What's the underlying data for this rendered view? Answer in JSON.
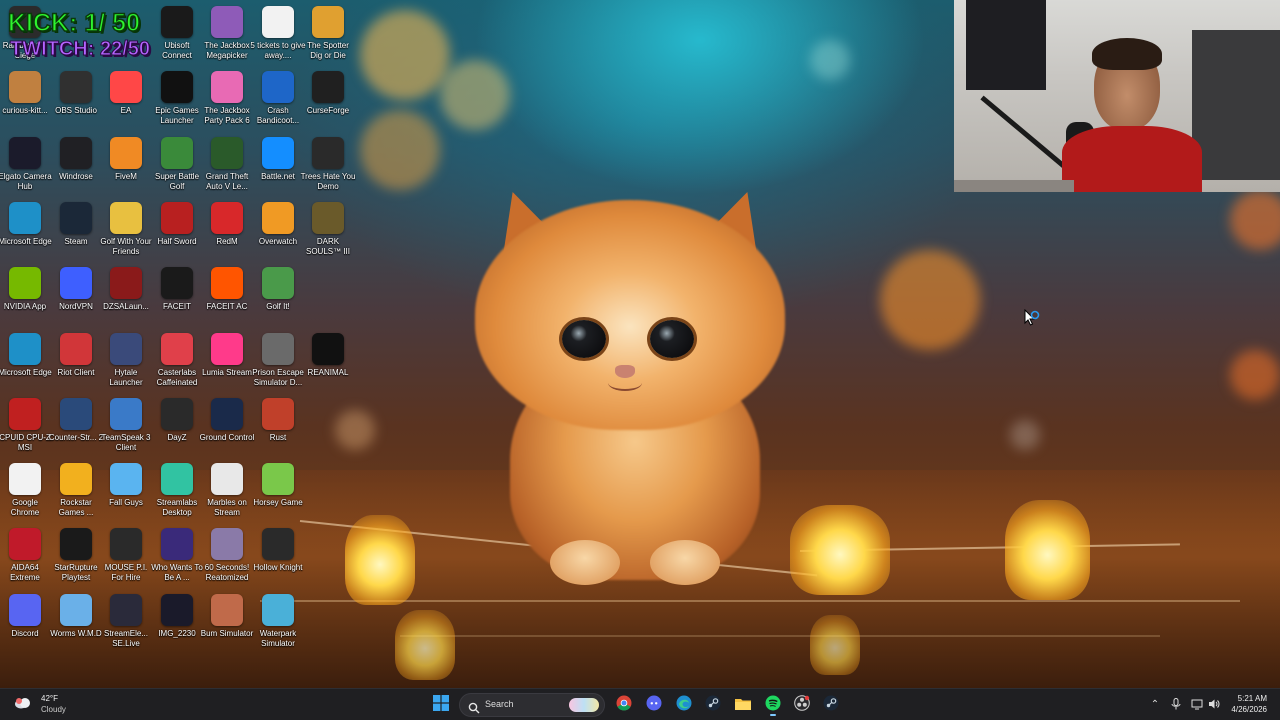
{
  "overlay": {
    "kick_counter": "KICK: 1/ 50",
    "twitch_counter": "TWITCH: 22/50"
  },
  "desktop_icons": [
    {
      "label": "Rainbow Six Siege",
      "icon": "r6-icon",
      "color": "#2b2b2b"
    },
    {
      "label": "Ubisoft Connect",
      "icon": "ubisoft-icon",
      "color": "#1a1a1a"
    },
    {
      "label": "The Jackbox Megapicker",
      "icon": "jackbox-icon",
      "color": "#8e5bb8"
    },
    {
      "label": "5 tickets to give away....",
      "icon": "document-icon",
      "color": "#f2f2f2"
    },
    {
      "label": "The Spotter Dig or Die",
      "icon": "spotter-icon",
      "color": "#e0a030"
    },
    {
      "label": "curious-kitt...",
      "icon": "file-icon",
      "color": "#c08040"
    },
    {
      "label": "OBS Studio",
      "icon": "obs-icon",
      "color": "#303030"
    },
    {
      "label": "EA",
      "icon": "ea-icon",
      "color": "#ff4747"
    },
    {
      "label": "Epic Games Launcher",
      "icon": "epic-icon",
      "color": "#111111"
    },
    {
      "label": "The Jackbox Party Pack 6",
      "icon": "jackbox6-icon",
      "color": "#e86ab4"
    },
    {
      "label": "Crash Bandicoot...",
      "icon": "crash-icon",
      "color": "#1e66c8"
    },
    {
      "label": "CurseForge",
      "icon": "curseforge-icon",
      "color": "#202020"
    },
    {
      "label": "Elgato Camera Hub",
      "icon": "elgato-icon",
      "color": "#1b1b2b"
    },
    {
      "label": "Windrose",
      "icon": "windrose-icon",
      "color": "#202024"
    },
    {
      "label": "FiveM",
      "icon": "fivem-icon",
      "color": "#f08a24"
    },
    {
      "label": "Super Battle Golf",
      "icon": "golf-icon",
      "color": "#3a8a3a"
    },
    {
      "label": "Grand Theft Auto V Le...",
      "icon": "gta-icon",
      "color": "#2a5a2a"
    },
    {
      "label": "Battle.net",
      "icon": "battlenet-icon",
      "color": "#148eff"
    },
    {
      "label": "Trees Hate You Demo",
      "icon": "tree-icon",
      "color": "#2a2a2a"
    },
    {
      "label": "Microsoft Edge",
      "icon": "edge-icon",
      "color": "#1e90c8"
    },
    {
      "label": "Steam",
      "icon": "steam-icon",
      "color": "#1b2838"
    },
    {
      "label": "Golf With Your Friends",
      "icon": "gwyf-icon",
      "color": "#e8c040"
    },
    {
      "label": "Half Sword",
      "icon": "halfsword-icon",
      "color": "#b82020"
    },
    {
      "label": "RedM",
      "icon": "redm-icon",
      "color": "#d8282a"
    },
    {
      "label": "Overwatch",
      "icon": "overwatch-icon",
      "color": "#f09a24"
    },
    {
      "label": "DARK SOULS™ III",
      "icon": "darksouls-icon",
      "color": "#6a5a2a"
    },
    {
      "label": "NVIDIA App",
      "icon": "nvidia-icon",
      "color": "#76b900"
    },
    {
      "label": "NordVPN",
      "icon": "nordvpn-icon",
      "color": "#3e5fff"
    },
    {
      "label": "DZSALaun...",
      "icon": "dzsa-icon",
      "color": "#8a1a1a"
    },
    {
      "label": "FACEIT",
      "icon": "faceit-icon",
      "color": "#1a1a1a"
    },
    {
      "label": "FACEIT AC",
      "icon": "faceitac-icon",
      "color": "#ff5500"
    },
    {
      "label": "Golf It!",
      "icon": "golfit-icon",
      "color": "#4a9a4a"
    },
    {
      "label": "Microsoft Edge",
      "icon": "edge-icon",
      "color": "#1e90c8"
    },
    {
      "label": "Riot Client",
      "icon": "riot-icon",
      "color": "#d13639"
    },
    {
      "label": "Hytale Launcher",
      "icon": "hytale-icon",
      "color": "#3a4a7a"
    },
    {
      "label": "Casterlabs Caffeinated",
      "icon": "casterlabs-icon",
      "color": "#e0404a"
    },
    {
      "label": "Lumia Stream",
      "icon": "lumia-icon",
      "color": "#ff3a8a"
    },
    {
      "label": "Prison Escape Simulator D...",
      "icon": "prison-icon",
      "color": "#6a6a6a"
    },
    {
      "label": "REANIMAL",
      "icon": "reanimal-icon",
      "color": "#111111"
    },
    {
      "label": "CPUID CPU-Z MSI",
      "icon": "cpuz-icon",
      "color": "#c02020"
    },
    {
      "label": "Counter-Str... 2",
      "icon": "cs2-icon",
      "color": "#2a4a7a"
    },
    {
      "label": "TeamSpeak 3 Client",
      "icon": "teamspeak-icon",
      "color": "#3a7ac8"
    },
    {
      "label": "DayZ",
      "icon": "dayz-icon",
      "color": "#2a2a2a"
    },
    {
      "label": "Ground Control",
      "icon": "groundcontrol-icon",
      "color": "#1a2a4a"
    },
    {
      "label": "Rust",
      "icon": "rust-icon",
      "color": "#c0402a"
    },
    {
      "label": "Google Chrome",
      "icon": "chrome-icon",
      "color": "#f2f2f2"
    },
    {
      "label": "Rockstar Games ...",
      "icon": "rockstar-icon",
      "color": "#f2b01e"
    },
    {
      "label": "Fall Guys",
      "icon": "fallguys-icon",
      "color": "#5ab4f0"
    },
    {
      "label": "Streamlabs Desktop",
      "icon": "streamlabs-icon",
      "color": "#31c3a2"
    },
    {
      "label": "Marbles on Stream",
      "icon": "marbles-icon",
      "color": "#e8e8e8"
    },
    {
      "label": "Horsey Game",
      "icon": "horsey-icon",
      "color": "#7ac84a"
    },
    {
      "label": "AIDA64 Extreme",
      "icon": "aida64-icon",
      "color": "#c01a2a"
    },
    {
      "label": "StarRupture Playtest",
      "icon": "starrupture-icon",
      "color": "#1a1a1a"
    },
    {
      "label": "MOUSE P.I. For Hire",
      "icon": "mousepi-icon",
      "color": "#2a2a2a"
    },
    {
      "label": "Who Wants To Be A ...",
      "icon": "millionaire-icon",
      "color": "#3a2a7a"
    },
    {
      "label": "60 Seconds! Reatomized",
      "icon": "60seconds-icon",
      "color": "#8a7aa8"
    },
    {
      "label": "Hollow Knight",
      "icon": "hollowknight-icon",
      "color": "#2a2a2a"
    },
    {
      "label": "Discord",
      "icon": "discord-icon",
      "color": "#5865f2"
    },
    {
      "label": "Worms W.M.D",
      "icon": "worms-icon",
      "color": "#6ab0e8"
    },
    {
      "label": "StreamEle... SE.Live",
      "icon": "streamelements-icon",
      "color": "#2a2a3a"
    },
    {
      "label": "IMG_2230",
      "icon": "image-file-icon",
      "color": "#1a1a2a"
    },
    {
      "label": "Bum Simulator",
      "icon": "bumsim-icon",
      "color": "#c06a4a"
    },
    {
      "label": "Waterpark Simulator",
      "icon": "waterpark-icon",
      "color": "#4ab0d8"
    }
  ],
  "taskbar": {
    "weather_temp": "42°F",
    "weather_condition": "Cloudy",
    "search_label": "Search",
    "clock_time": "5:21 AM",
    "clock_date": "4/26/2026",
    "pinned": [
      {
        "name": "start-button",
        "icon": "windows-icon"
      },
      {
        "name": "search-box",
        "icon": "search-icon"
      },
      {
        "name": "chrome-taskbar-button",
        "icon": "chrome-icon"
      },
      {
        "name": "discord-taskbar-button",
        "icon": "discord-icon"
      },
      {
        "name": "edge-taskbar-button",
        "icon": "edge-icon"
      },
      {
        "name": "steam-taskbar-button",
        "icon": "steam-icon"
      },
      {
        "name": "file-explorer-taskbar-button",
        "icon": "folder-icon"
      },
      {
        "name": "spotify-taskbar-button",
        "icon": "spotify-icon"
      },
      {
        "name": "obs-taskbar-button",
        "icon": "obs-icon"
      },
      {
        "name": "steam-taskbar-button-2",
        "icon": "steam-icon"
      }
    ]
  },
  "colors": {
    "taskbar_bg": "#1f1f22",
    "kick_green": "#2ef52e",
    "twitch_purple": "#b565ff",
    "accent_blue": "#7fc9ff"
  }
}
